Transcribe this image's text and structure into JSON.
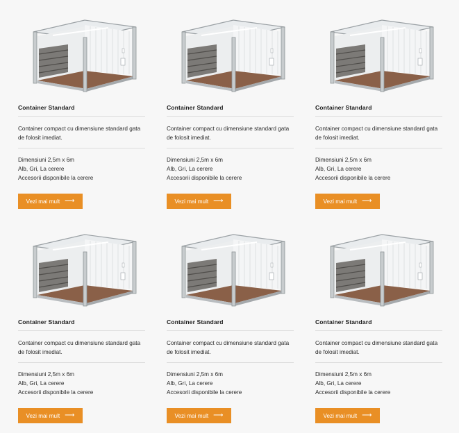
{
  "colors": {
    "accent": "#e98f25",
    "background": "#f7f7f7"
  },
  "cards": [
    {
      "title": "Container Standard",
      "description": "Container compact cu dimensiune standard gata de folosit imediat.",
      "specs": [
        "Dimensiuni 2,5m x 6m",
        "Alb, Gri, La cerere",
        "Accesorii disponibile la cerere"
      ],
      "button": "Vezi mai mult",
      "icon": "arrow-right-icon"
    },
    {
      "title": "Container Standard",
      "description": "Container compact cu dimensiune standard gata de folosit imediat.",
      "specs": [
        "Dimensiuni 2,5m x 6m",
        "Alb, Gri, La cerere",
        "Accesorii disponibile la cerere"
      ],
      "button": "Vezi mai mult",
      "icon": "arrow-right-icon"
    },
    {
      "title": "Container Standard",
      "description": "Container compact cu dimensiune standard gata de folosit imediat.",
      "specs": [
        "Dimensiuni 2,5m x 6m",
        "Alb, Gri, La cerere",
        "Accesorii disponibile la cerere"
      ],
      "button": "Vezi mai mult",
      "icon": "arrow-right-icon"
    },
    {
      "title": "Container Standard",
      "description": "Container compact cu dimensiune standard gata de folosit imediat.",
      "specs": [
        "Dimensiuni 2,5m x 6m",
        "Alb, Gri, La cerere",
        "Accesorii disponibile la cerere"
      ],
      "button": "Vezi mai mult",
      "icon": "arrow-right-icon"
    },
    {
      "title": "Container Standard",
      "description": "Container compact cu dimensiune standard gata de folosit imediat.",
      "specs": [
        "Dimensiuni 2,5m x 6m",
        "Alb, Gri, La cerere",
        "Accesorii disponibile la cerere"
      ],
      "button": "Vezi mai mult",
      "icon": "arrow-right-icon"
    },
    {
      "title": "Container Standard",
      "description": "Container compact cu dimensiune standard gata de folosit imediat.",
      "specs": [
        "Dimensiuni 2,5m x 6m",
        "Alb, Gri, La cerere",
        "Accesorii disponibile la cerere"
      ],
      "button": "Vezi mai mult",
      "icon": "arrow-right-icon"
    }
  ]
}
